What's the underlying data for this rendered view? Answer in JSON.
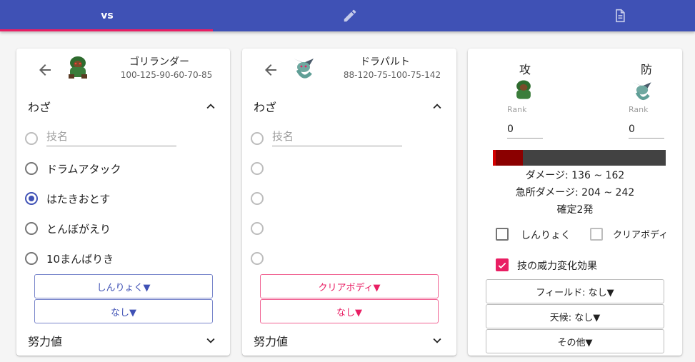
{
  "tabs": {
    "vs_label": "vs",
    "edit_icon": "pencil-icon",
    "doc_icon": "document-icon"
  },
  "colors": {
    "primary": "#3f51b5",
    "accent": "#e91e63",
    "damage_bar": "#8b0000"
  },
  "attacker": {
    "name": "ゴリランダー",
    "stats": "100-125-90-60-70-85",
    "moves_heading": "わざ",
    "move_placeholder": "技名",
    "moves": [
      "ドラムアタック",
      "はたきおとす",
      "とんぼがえり",
      "10まんばりき"
    ],
    "selected_move_index": 1,
    "ability_button": "しんりょく▼",
    "item_button": "なし▼",
    "ev_heading": "努力値"
  },
  "defender": {
    "name": "ドラパルト",
    "stats": "88-120-75-100-75-142",
    "moves_heading": "わざ",
    "move_placeholder": "技名",
    "moves": [
      "",
      "",
      "",
      ""
    ],
    "ability_button": "クリアボディ▼",
    "item_button": "なし▼",
    "ev_heading": "努力値"
  },
  "calc": {
    "attack_label": "攻",
    "defense_label": "防",
    "rank_label": "Rank",
    "attack_rank": "0",
    "defense_rank": "0",
    "damage_bar_fraction": 0.175,
    "damage_text": "ダメージ: 136 ~ 162",
    "crit_text": "急所ダメージ: 204 ~ 242",
    "ko_text": "確定2発",
    "attacker_ability_checkbox": "しんりょく",
    "defender_ability_checkbox": "クリアボディ",
    "power_modifier_checkbox": "技の威力変化効果",
    "field_button": "フィールド: なし▼",
    "weather_button": "天候: なし▼",
    "other_button": "その他▼"
  }
}
